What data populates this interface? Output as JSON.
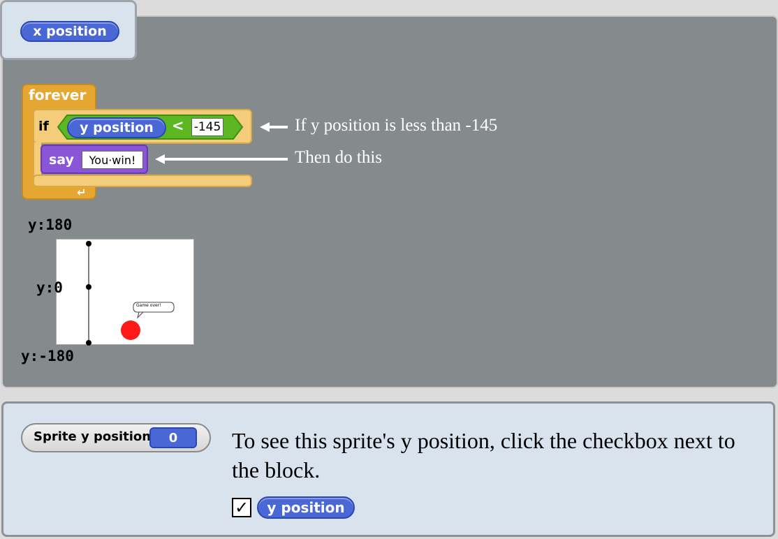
{
  "palette": {
    "x_position": "x position"
  },
  "script": {
    "forever_label": "forever",
    "if_label": "if",
    "condition_reporter": "y position",
    "operator": "<",
    "threshold": "-145",
    "say_label": "say",
    "say_text": "You·win!"
  },
  "annotations": {
    "condition_note": "If y position is less than -145",
    "action_note": "Then do this"
  },
  "stage": {
    "y_top": "y:180",
    "y_mid": "y:0",
    "y_bottom": "y:-180",
    "speech_text": "Game over!"
  },
  "help": {
    "watcher_label": "Sprite y position",
    "watcher_value": "0",
    "instruction": "To see this sprite's y position, click the checkbox next to the block.",
    "checkbox_mark": "✓",
    "block_label": "y position"
  },
  "colors": {
    "motion_blue": "#4a67d6",
    "control_orange": "#e6a632",
    "looks_purple": "#8a55d7",
    "operator_green": "#5cb722",
    "sprite_red": "#ff1a1a"
  }
}
